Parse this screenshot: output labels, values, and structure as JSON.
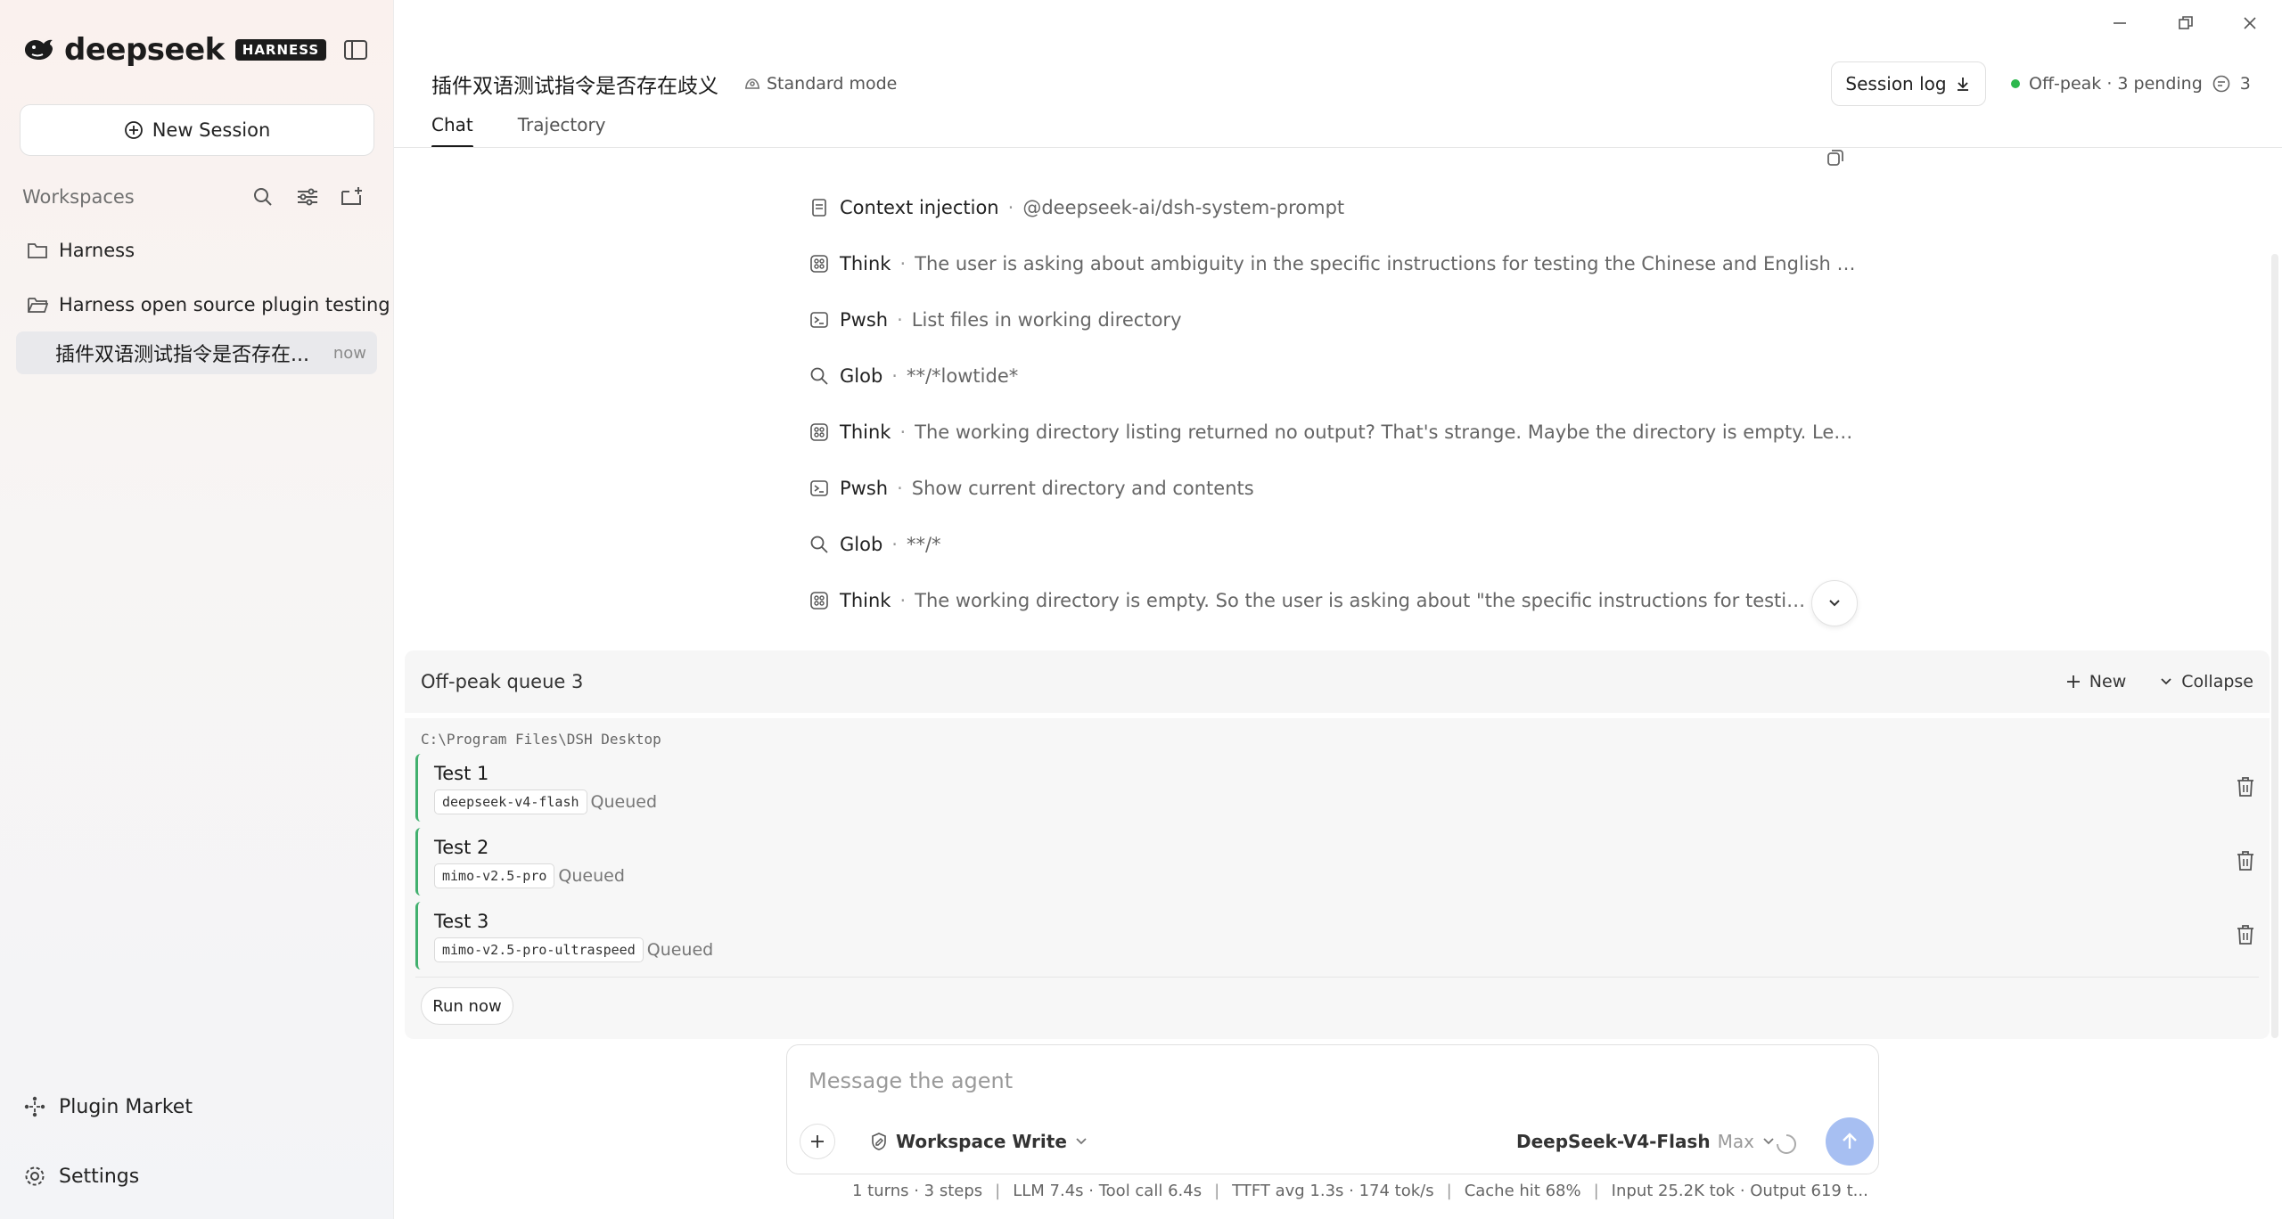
{
  "sidebar": {
    "brand": "deepseek",
    "badge": "HARNESS",
    "new_session_label": "New Session",
    "workspaces_label": "Workspaces",
    "workspaces": [
      {
        "label": "Harness"
      },
      {
        "label": "Harness open source plugin testing"
      }
    ],
    "active_session": {
      "title": "插件双语测试指令是否存在...",
      "time": "now"
    },
    "plugin_market": "Plugin Market",
    "settings": "Settings"
  },
  "header": {
    "title": "插件双语测试指令是否存在歧义",
    "mode": "Standard mode",
    "session_log": "Session log",
    "status": "Off-peak · 3 pending",
    "comment_count": "3",
    "tabs": [
      {
        "label": "Chat",
        "active": true
      },
      {
        "label": "Trajectory",
        "active": false
      }
    ]
  },
  "steps": [
    {
      "icon": "document-icon",
      "name": "Context injection",
      "desc": "@deepseek-ai/dsh-system-prompt"
    },
    {
      "icon": "think-icon",
      "name": "Think",
      "desc": "The user is asking about ambiguity in the specific instructions for testing the Chinese and English versions o..."
    },
    {
      "icon": "terminal-icon",
      "name": "Pwsh",
      "desc": "List files in working directory"
    },
    {
      "icon": "search-icon",
      "name": "Glob",
      "desc": "**/*lowtide*"
    },
    {
      "icon": "think-icon",
      "name": "Think",
      "desc": "The working directory listing returned no output? That's strange. Maybe the directory is empty. Let me chec..."
    },
    {
      "icon": "terminal-icon",
      "name": "Pwsh",
      "desc": "Show current directory and contents"
    },
    {
      "icon": "search-icon",
      "name": "Glob",
      "desc": "**/*"
    },
    {
      "icon": "think-icon",
      "name": "Think",
      "desc": "The working directory is empty. So the user is asking about \"the specific instructions for testing the Chin"
    }
  ],
  "queue": {
    "title": "Off-peak queue 3",
    "new_label": "New",
    "collapse_label": "Collapse",
    "path": "C:\\Program Files\\DSH Desktop",
    "items": [
      {
        "name": "Test 1",
        "model": "deepseek-v4-flash",
        "status": "Queued"
      },
      {
        "name": "Test 2",
        "model": "mimo-v2.5-pro",
        "status": "Queued"
      },
      {
        "name": "Test 3",
        "model": "mimo-v2.5-pro-ultraspeed",
        "status": "Queued"
      }
    ],
    "run_now": "Run now"
  },
  "composer": {
    "placeholder": "Message the agent",
    "permission": "Workspace Write",
    "model": "DeepSeek-V4-Flash",
    "effort": "Max"
  },
  "stats": [
    "1 turns · 3 steps",
    "LLM 7.4s · Tool call 6.4s",
    "TTFT avg 1.3s · 174 tok/s",
    "Cache hit 68%",
    "Input 25.2K tok · Output 619 t..."
  ],
  "colors": {
    "accent_green": "#41b06e",
    "send_button": "#a7bff2",
    "status_dot": "#2db84d"
  }
}
